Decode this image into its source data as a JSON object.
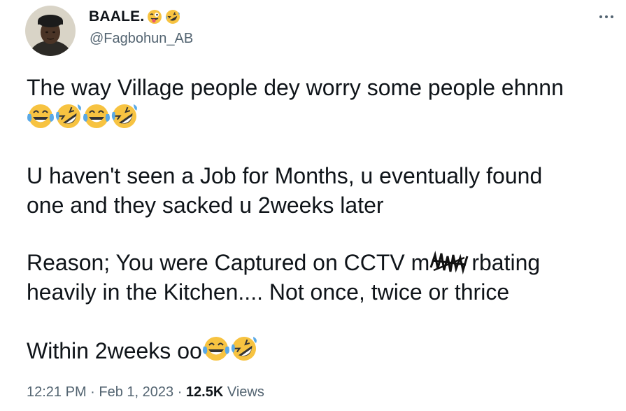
{
  "author": {
    "name": "BAALE.",
    "name_emojis": [
      "winking-face-with-tongue",
      "rolling-on-floor-laughing"
    ],
    "handle": "@Fagbohun_AB"
  },
  "tweet": {
    "line1": "The way Village people dey worry some people ehnnn",
    "line1_emojis": [
      "face-with-tears-of-joy",
      "rolling-on-floor-laughing",
      "face-with-tears-of-joy",
      "rolling-on-floor-laughing"
    ],
    "para2_line1": "U haven't seen a Job for Months, u eventually found",
    "para2_line2": "one and they sacked u 2weeks later",
    "para3_prefix": "Reason; You were Captured on CCTV m",
    "para3_suffix": "rbating",
    "para3_line2": "heavily in the Kitchen.... Not once, twice or thrice",
    "para4": "Within 2weeks oo",
    "para4_emojis": [
      "face-with-tears-of-joy",
      "rolling-on-floor-laughing"
    ]
  },
  "meta": {
    "time": "12:21 PM",
    "separator": " · ",
    "date": "Feb 1, 2023",
    "views_count": "12.5K",
    "views_label": " Views"
  },
  "colors": {
    "text": "#0f1419",
    "secondary": "#536471",
    "emoji_yellow": "#f7c341",
    "emoji_tear": "#5aa9e6"
  }
}
